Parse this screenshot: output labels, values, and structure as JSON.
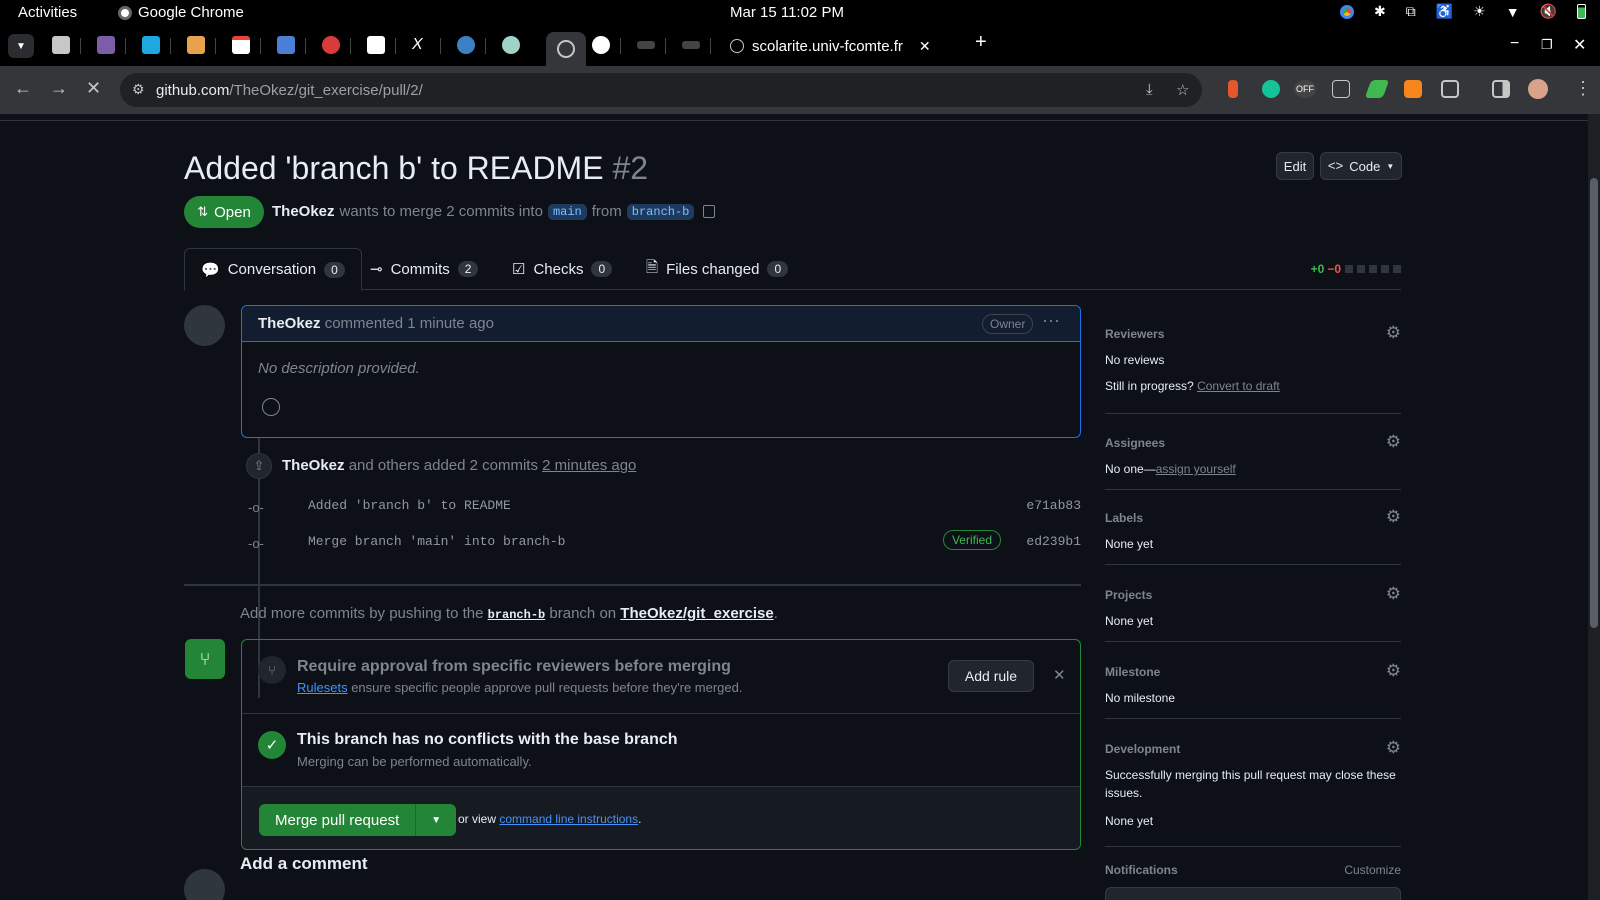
{
  "system_bar": {
    "activities": "Activities",
    "app_name": "Google Chrome",
    "clock": "Mar 15  11:02 PM"
  },
  "browser": {
    "tab_title": "scolarite.univ-fcomte.fr",
    "url_host": "github.com",
    "url_path": "/TheOkez/git_exercise/pull/2/"
  },
  "pr": {
    "title": "Added 'branch b' to README",
    "number": "#2",
    "edit_label": "Edit",
    "code_label": "Code",
    "state": "Open",
    "author": "TheOkez",
    "merge_text": "wants to merge 2 commits into",
    "base_branch": "main",
    "from_text": "from",
    "head_branch": "branch-b"
  },
  "tabs": [
    {
      "label": "Conversation",
      "count": "0"
    },
    {
      "label": "Commits",
      "count": "2"
    },
    {
      "label": "Checks",
      "count": "0"
    },
    {
      "label": "Files changed",
      "count": "0"
    }
  ],
  "diffstat": {
    "added": "+0",
    "removed": "−0"
  },
  "comment": {
    "author": "TheOkez",
    "action": "commented 1 minute ago",
    "role": "Owner",
    "body": "No description provided."
  },
  "push_event": {
    "author": "TheOkez",
    "text": "and others added 2 commits",
    "time": "2 minutes ago"
  },
  "commits": [
    {
      "message": "Added 'branch b' to README",
      "sha": "e71ab83",
      "verified": ""
    },
    {
      "message": "Merge branch 'main' into branch-b",
      "sha": "ed239b1",
      "verified": "Verified"
    }
  ],
  "add_more": {
    "prefix": "Add more commits by pushing to the",
    "branch": "branch-b",
    "middle": "branch on",
    "repo": "TheOkez/git_exercise",
    "suffix": "."
  },
  "merge": {
    "rule_title": "Require approval from specific reviewers before merging",
    "rule_link": "Rulesets",
    "rule_desc": "ensure specific people approve pull requests before they're merged.",
    "add_rule": "Add rule",
    "status_title": "This branch has no conflicts with the base branch",
    "status_desc": "Merging can be performed automatically.",
    "merge_button": "Merge pull request",
    "or_view": "or view",
    "cli_link": "command line instructions",
    "cli_suffix": "."
  },
  "add_comment": "Add a comment",
  "sidebar": {
    "reviewers": {
      "heading": "Reviewers",
      "value": "No reviews",
      "progress_text": "Still in progress?",
      "draft_link": "Convert to draft"
    },
    "assignees": {
      "heading": "Assignees",
      "value": "No one—",
      "assign_link": "assign yourself"
    },
    "labels": {
      "heading": "Labels",
      "value": "None yet"
    },
    "projects": {
      "heading": "Projects",
      "value": "None yet"
    },
    "milestone": {
      "heading": "Milestone",
      "value": "No milestone"
    },
    "development": {
      "heading": "Development",
      "value": "Successfully merging this pull request may close these",
      "value2": "issues.",
      "value3": "None yet"
    },
    "notifications": {
      "heading": "Notifications",
      "customize": "Customize"
    }
  },
  "colors": {
    "open_green": "#238636",
    "link_blue": "#4493f8",
    "bg": "#0d1117"
  }
}
